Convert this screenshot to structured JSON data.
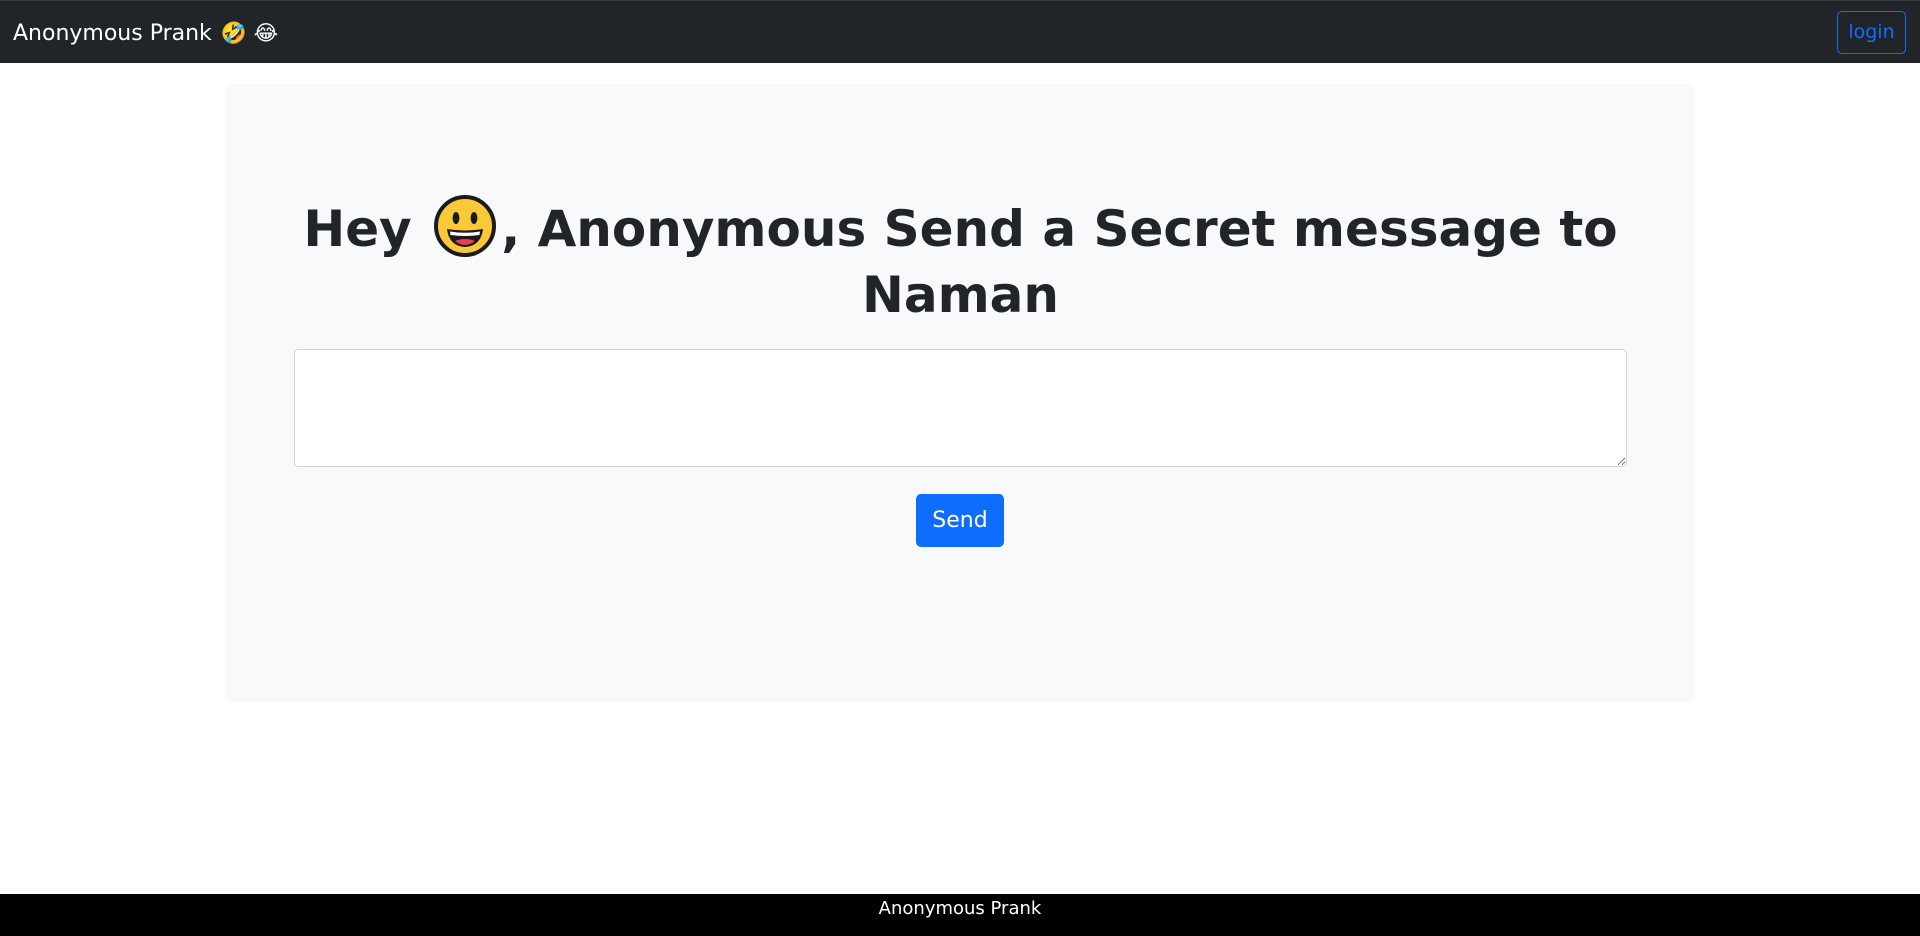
{
  "navbar": {
    "brand": "Anonymous Prank",
    "brand_emojis": "🤣 😂",
    "login_label": "login"
  },
  "main": {
    "headline_before": "Hey ",
    "headline_after": ", Anonymous Send a Secret message to Naman",
    "smiley_icon": "grinning-face-icon",
    "message_value": "",
    "message_placeholder": "",
    "send_label": "Send"
  },
  "footer": {
    "text": "Anonymous Prank"
  },
  "colors": {
    "navbar_bg": "#212529",
    "accent": "#0d6efd",
    "panel_bg": "#f8f9fa",
    "footer_bg": "#000000"
  }
}
